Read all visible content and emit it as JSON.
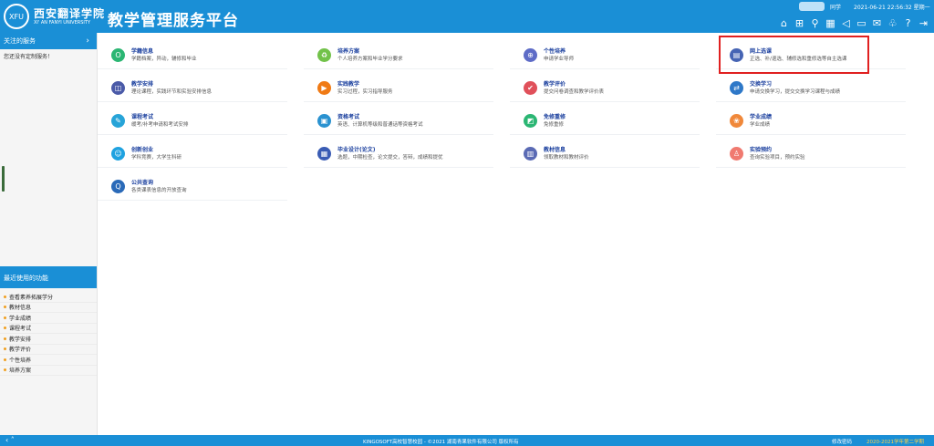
{
  "header": {
    "logo_cn": "西安翻译学院",
    "logo_en": "XI' AN FANYI UNIVERSITY",
    "logo_emblem": "XFU",
    "app_title": "教学管理服务平台",
    "user_name": "同学",
    "datetime": "2021-06-21 22:56:32 星期一",
    "icons": [
      "home-icon",
      "grid-icon",
      "search-icon",
      "calendar-icon",
      "announce-icon",
      "window-icon",
      "message-icon",
      "shirt-icon",
      "help-icon",
      "logout-icon"
    ]
  },
  "sidebar": {
    "follow_title": "关注的服务",
    "follow_note": "您还没有定制服务！",
    "recent_title": "最近使用的功能",
    "recent_items": [
      "查看素养拓展学分",
      "教材信息",
      "学业成绩",
      "课程考试",
      "教学安排",
      "教学评价",
      "个性培养",
      "培养方案"
    ]
  },
  "cards": [
    {
      "title": "学籍信息",
      "desc": "学籍档案，异动，辅修和毕业",
      "color": "#2bb673",
      "icon": "O"
    },
    {
      "title": "培养方案",
      "desc": "个人培养方案和毕业学分要求",
      "color": "#72c24a",
      "icon": "♻"
    },
    {
      "title": "个性培养",
      "desc": "申请学业导师",
      "color": "#5e6cc7",
      "icon": "⊕"
    },
    {
      "title": "网上选课",
      "desc": "正选、补/退选、辅修选和重修选等自主选课",
      "color": "#4664b4",
      "icon": "▤"
    },
    {
      "title": "教学安排",
      "desc": "理论课程，实践环节和实验安排信息",
      "color": "#4a5aa8",
      "icon": "◫"
    },
    {
      "title": "实践教学",
      "desc": "实习过程，实习指导服务",
      "color": "#f07a14",
      "icon": "▶"
    },
    {
      "title": "教学评价",
      "desc": "提交问卷调查和教学评价表",
      "color": "#e0505a",
      "icon": "✔"
    },
    {
      "title": "交换学习",
      "desc": "申请交换学习，提交交换学习课程与成绩",
      "color": "#2e78c8",
      "icon": "⇄"
    },
    {
      "title": "课程考试",
      "desc": "缓考/补考申请和考试安排",
      "color": "#27a4d8",
      "icon": "✎"
    },
    {
      "title": "资格考试",
      "desc": "英语、计算机等级和普通话等资格考试",
      "color": "#2a92d0",
      "icon": "▣"
    },
    {
      "title": "免修重修",
      "desc": "免修重修",
      "color": "#2bb673",
      "icon": "◩"
    },
    {
      "title": "学业成绩",
      "desc": "学业成绩",
      "color": "#f0883a",
      "icon": "❀"
    },
    {
      "title": "创新创业",
      "desc": "学科竞赛，大学生科研",
      "color": "#1fa2e0",
      "icon": "☺"
    },
    {
      "title": "毕业设计(论文)",
      "desc": "选题，中期检查，论文提交，答辩，成绩和提优",
      "color": "#3a5cb4",
      "icon": "▦"
    },
    {
      "title": "教材信息",
      "desc": "领取教材和教材评价",
      "color": "#5a6ab4",
      "icon": "▥"
    },
    {
      "title": "实验预约",
      "desc": "查询实验项目，预约实验",
      "color": "#f07a70",
      "icon": "♙"
    },
    {
      "title": "公共查询",
      "desc": "各类课表信息的开放查询",
      "color": "#2a6ab8",
      "icon": "Q"
    }
  ],
  "footer": {
    "nav_left": "‹  ˄",
    "copyright": "KINGOSOFT高校智慧校园 - ©2021 湖南青果软件有限公司 版权所有",
    "change_password": "修改密码",
    "term": "2020-2021学年第二学期"
  }
}
